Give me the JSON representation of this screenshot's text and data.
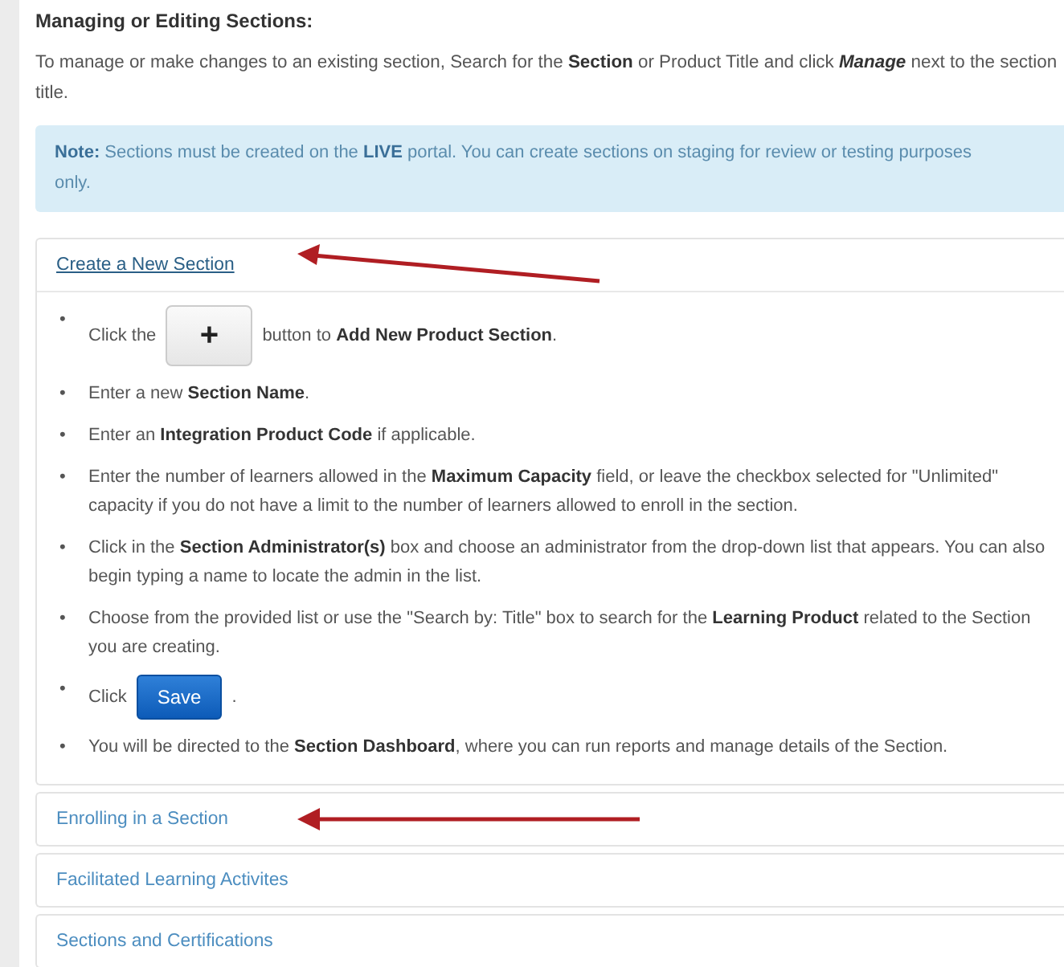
{
  "heading": "Managing or Editing Sections:",
  "intro": "To manage or make changes to an existing section, Search for the **Section** or Product Title and click *Manage* next to the section title.",
  "note": "**Note:** Sections must be created on the **LIVE** portal. You can create sections on staging for review or testing purposes only.",
  "bullet": "•",
  "sections": [
    {
      "title": "Create a New Section",
      "expanded": true,
      "arrow": true,
      "steps": [
        {
          "kind": "plus",
          "before": "Click the",
          "button": "+",
          "after": "button to **Add New Product Section**."
        },
        {
          "kind": "text",
          "text": "Enter a new **Section Name**."
        },
        {
          "kind": "text",
          "text": "Enter an **Integration Product Code** if applicable."
        },
        {
          "kind": "text",
          "text": "Enter the number of learners allowed in the **Maximum Capacity** field, or leave the checkbox selected for \"Unlimited\" capacity if you do not have a limit to the number of learners allowed to enroll in the section."
        },
        {
          "kind": "text",
          "text": "Click in the **Section Administrator(s)** box and choose an administrator from the drop-down list that appears. You can also begin typing a name to locate the admin in the list."
        },
        {
          "kind": "text",
          "text": "Choose from the provided list or use the \"Search by: Title\" box to search for the **Learning Product** related to the Section you are creating."
        },
        {
          "kind": "save",
          "before": "Click",
          "button": "Save",
          "after": "."
        },
        {
          "kind": "text",
          "text": "You will be directed to the **Section Dashboard**, where you can run reports and manage details of the Section."
        }
      ]
    },
    {
      "title": "Enrolling in a Section",
      "expanded": false,
      "arrow": true
    },
    {
      "title": "Facilitated Learning Activites",
      "expanded": false,
      "arrow": false
    },
    {
      "title": "Sections and Certifications",
      "expanded": false,
      "arrow": false
    }
  ]
}
